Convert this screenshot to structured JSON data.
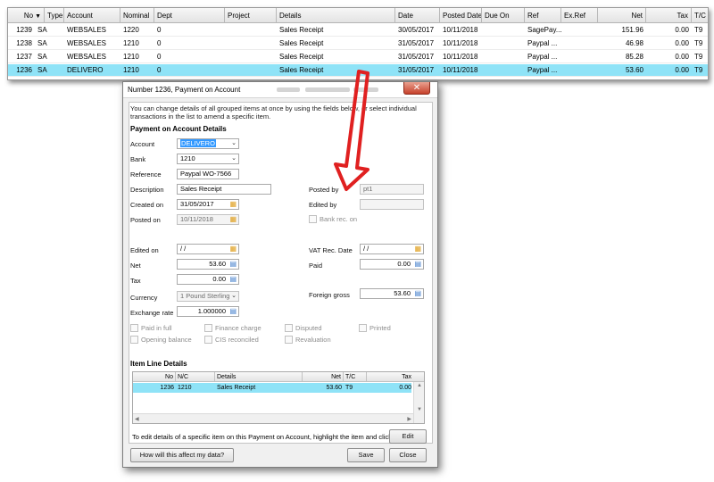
{
  "grid": {
    "columns": [
      "No",
      "Type",
      "Account",
      "Nominal",
      "Dept",
      "Project",
      "Details",
      "Date",
      "Posted Date",
      "Due On",
      "Ref",
      "Ex.Ref",
      "Net",
      "Tax",
      "T/C"
    ],
    "rows": [
      {
        "no": "1239",
        "type": "SA",
        "account": "WEBSALES",
        "nominal": "1220",
        "dept": "0",
        "details": "Sales Receipt",
        "date": "30/05/2017",
        "posted": "10/11/2018",
        "ref": "SagePay...",
        "net": "151.96",
        "tax": "0.00",
        "tc": "T9"
      },
      {
        "no": "1238",
        "type": "SA",
        "account": "WEBSALES",
        "nominal": "1210",
        "dept": "0",
        "details": "Sales Receipt",
        "date": "31/05/2017",
        "posted": "10/11/2018",
        "ref": "Paypal ...",
        "net": "46.98",
        "tax": "0.00",
        "tc": "T9"
      },
      {
        "no": "1237",
        "type": "SA",
        "account": "WEBSALES",
        "nominal": "1210",
        "dept": "0",
        "details": "Sales Receipt",
        "date": "31/05/2017",
        "posted": "10/11/2018",
        "ref": "Paypal ...",
        "net": "85.28",
        "tax": "0.00",
        "tc": "T9"
      },
      {
        "no": "1236",
        "type": "SA",
        "account": "DELIVERO",
        "nominal": "1210",
        "dept": "0",
        "details": "Sales Receipt",
        "date": "31/05/2017",
        "posted": "10/11/2018",
        "ref": "Paypal ...",
        "net": "53.60",
        "tax": "0.00",
        "tc": "T9"
      }
    ]
  },
  "dialog": {
    "title": "Number 1236, Payment on Account",
    "close_glyph": "✕",
    "instructions": "You can change details of all grouped items at once by using the fields below, or select individual transactions in the list to amend a specific item.",
    "section_details": "Payment on Account Details",
    "labels": {
      "account": "Account",
      "bank": "Bank",
      "reference": "Reference",
      "description": "Description",
      "created_on": "Created on",
      "posted_on": "Posted on",
      "posted_by": "Posted by",
      "edited_by": "Edited by",
      "bank_rec_on": "Bank rec. on",
      "edited_on": "Edited on",
      "vat_rec_date": "VAT Rec. Date",
      "net": "Net",
      "paid": "Paid",
      "tax": "Tax",
      "currency": "Currency",
      "foreign_gross": "Foreign gross",
      "exchange_rate": "Exchange rate"
    },
    "values": {
      "account": "DELIVERO",
      "bank": "1210",
      "reference": "Paypal WO-7566",
      "description": "Sales Receipt",
      "created_on": "31/05/2017",
      "posted_on": "10/11/2018",
      "posted_by": "pt1",
      "edited_by": "",
      "edited_on": "/ /",
      "vat_rec_date": "/ /",
      "net": "53.60",
      "paid": "0.00",
      "tax": "0.00",
      "currency": "1   Pound Sterling",
      "foreign_gross": "53.60",
      "exchange_rate": "1.000000"
    },
    "checkboxes": {
      "paid_in_full": "Paid in full",
      "finance_charge": "Finance charge",
      "disputed": "Disputed",
      "printed": "Printed",
      "opening_balance": "Opening balance",
      "cis_reconciled": "CIS reconciled",
      "revaluation": "Revaluation"
    },
    "section_items": "Item Line Details",
    "item_columns": [
      "No",
      "N/C",
      "Details",
      "Net",
      "T/C",
      "Tax"
    ],
    "item_row": {
      "no": "1236",
      "nc": "1210",
      "details": "Sales Receipt",
      "net": "53.60",
      "tc": "T9",
      "tax": "0.00"
    },
    "edit_hint": "To edit details of a specific item on this Payment on Account, highlight the item and click 'Edit'.",
    "buttons": {
      "edit": "Edit",
      "affect": "How will this affect my data?",
      "save": "Save",
      "close": "Close"
    }
  },
  "colors": {
    "selection": "#8fe3f7",
    "arrow": "#e02020",
    "highlight": "#3399ff"
  }
}
